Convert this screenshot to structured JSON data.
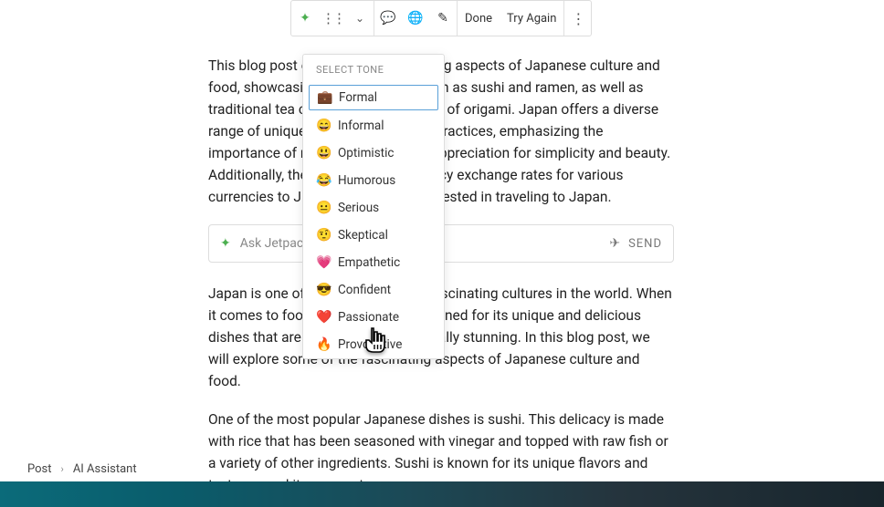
{
  "toolbar": {
    "done_label": "Done",
    "try_again_label": "Try Again"
  },
  "paragraphs": {
    "p1": "This blog post explores the fascinating aspects of Japanese culture and food, showcasing popular dishes such as sushi and ramen, as well as traditional tea ceremonies and the art of origami. Japan offers a diverse range of unique cuisine and cultural practices, emphasizing the importance of ritual, discipline, and appreciation for simplicity and beauty. Additionally, the blog provides currency exchange rates for various currencies to JPY for individuals interested in traveling to Japan.",
    "p2": "Japan is one of the most culturally fascinating cultures in the world. When it comes to food, the country is renowned for its unique and delicious dishes that are both healthy and visually stunning. In this blog post, we will explore some of the fascinating aspects of Japanese culture and food.",
    "p3": "One of the most popular Japanese dishes is sushi. This delicacy is made with rice that has been seasoned with vinegar and topped with raw fish or a variety of other ingredients. Sushi is known for its unique flavors and textures, and it represents an"
  },
  "ask_bar": {
    "placeholder": "Ask Jetpack AI",
    "send_label": "SEND"
  },
  "tone_menu": {
    "header": "SELECT TONE",
    "items": [
      {
        "emoji": "💼",
        "label": "Formal"
      },
      {
        "emoji": "😄",
        "label": "Informal"
      },
      {
        "emoji": "😃",
        "label": "Optimistic"
      },
      {
        "emoji": "😂",
        "label": "Humorous"
      },
      {
        "emoji": "😐",
        "label": "Serious"
      },
      {
        "emoji": "🤨",
        "label": "Skeptical"
      },
      {
        "emoji": "💗",
        "label": "Empathetic"
      },
      {
        "emoji": "😎",
        "label": "Confident"
      },
      {
        "emoji": "❤️",
        "label": "Passionate"
      },
      {
        "emoji": "🔥",
        "label": "Provocative"
      }
    ]
  },
  "breadcrumb": {
    "item1": "Post",
    "item2": "AI Assistant"
  }
}
